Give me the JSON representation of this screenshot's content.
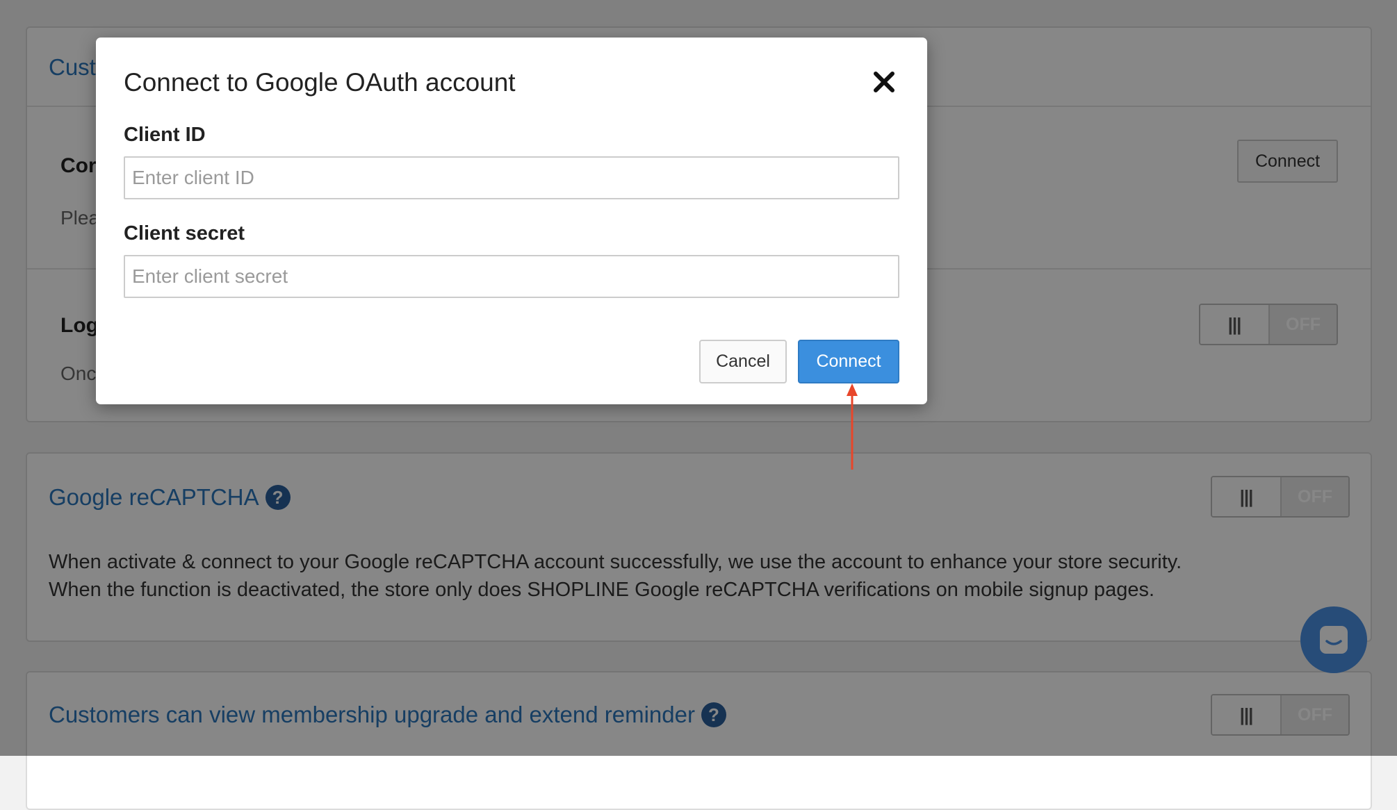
{
  "background": {
    "section_header_partial": "Cust",
    "row1": {
      "title_partial": "Cor",
      "desc_partial": "Plea",
      "connect_label": "Connect"
    },
    "row2": {
      "title_partial": "Log",
      "desc_partial": "Onc",
      "toggle_state": "OFF"
    },
    "recaptcha": {
      "title": "Google reCAPTCHA",
      "help_glyph": "?",
      "desc_line1": "When activate & connect to your Google reCAPTCHA account successfully, we use the account to enhance your store security.",
      "desc_line2": "When the function is deactivated, the store only does SHOPLINE Google reCAPTCHA verifications on mobile signup pages.",
      "toggle_state": "OFF"
    },
    "membership": {
      "title": "Customers can view membership upgrade and extend reminder",
      "help_glyph": "?",
      "toggle_state": "OFF"
    },
    "toggle_handle_glyph": "|||"
  },
  "modal": {
    "title": "Connect to Google OAuth account",
    "close_icon": "close-icon",
    "client_id": {
      "label": "Client ID",
      "placeholder": "Enter client ID",
      "value": ""
    },
    "client_secret": {
      "label": "Client secret",
      "placeholder": "Enter client secret",
      "value": ""
    },
    "cancel_label": "Cancel",
    "connect_label": "Connect"
  },
  "annotation": {
    "arrow_color": "#e8462a",
    "points_to": "modal-connect-button"
  },
  "colors": {
    "primary_button": "#3b8fde",
    "link_title": "#2a75bb",
    "chat_launcher": "#4a90e2"
  }
}
